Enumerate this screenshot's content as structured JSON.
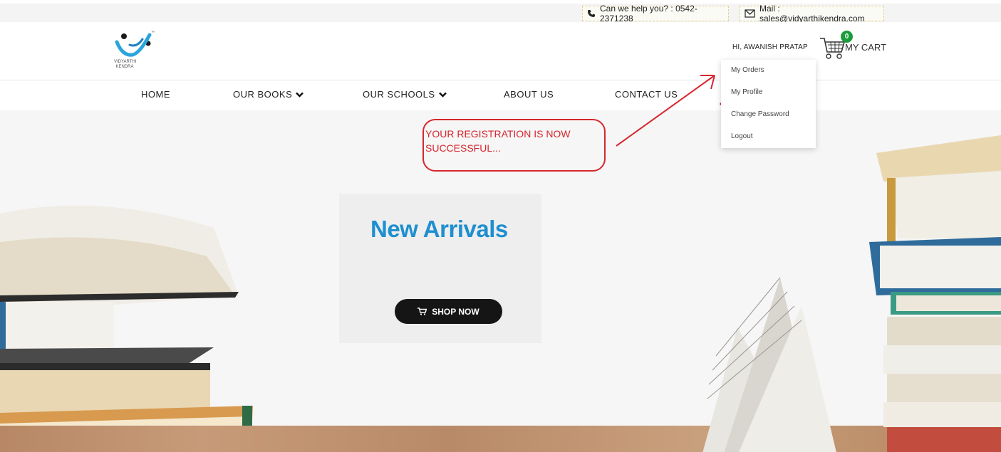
{
  "topbar": {
    "phone_icon": "phone-icon",
    "phone_text": "Can we help you? : 0542-2371238",
    "mail_icon": "mail-icon",
    "mail_text": "Mail : sales@vidyarthikendra.com"
  },
  "header": {
    "logo_text": "VIDYARTHI KENDRA",
    "logo_tm": "™",
    "greeting": "HI, AWANISH PRATAP",
    "cart_count": "0",
    "cart_label": "MY CART",
    "cart_icon": "shopping-cart-icon",
    "badge_color": "#1a9b3c"
  },
  "nav": {
    "items": [
      {
        "label": "HOME"
      },
      {
        "label": "OUR BOOKS"
      },
      {
        "label": "OUR SCHOOLS"
      },
      {
        "label": "ABOUT US"
      },
      {
        "label": "CONTACT US"
      }
    ]
  },
  "user_menu": {
    "items": [
      {
        "label": "My Orders"
      },
      {
        "label": "My Profile"
      },
      {
        "label": "Change Password"
      },
      {
        "label": "Logout"
      }
    ]
  },
  "annotation": {
    "text": "YOUR REGISTRATION IS NOW SUCCESSFUL...",
    "color": "#d6262e"
  },
  "hero": {
    "title": "New Arrivals",
    "title_color": "#1e8fd0",
    "shop_button": "SHOP NOW",
    "shop_icon": "cart-icon"
  }
}
